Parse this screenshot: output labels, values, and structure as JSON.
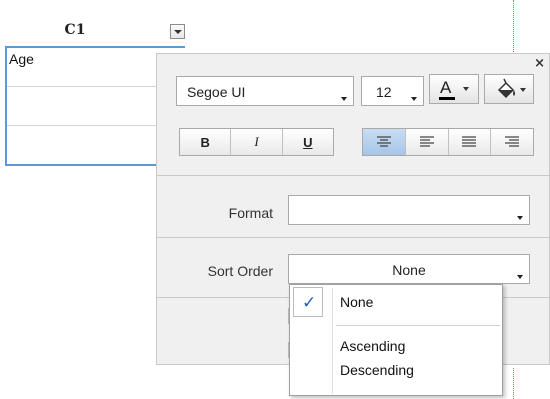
{
  "sheet": {
    "column_header": "C1",
    "cells": [
      "Age",
      "",
      ""
    ]
  },
  "panel": {
    "close_label": "×",
    "font_name": "Segoe UI",
    "font_size": "12",
    "font_color_glyph": "A",
    "fill_icon": "paint-bucket-icon",
    "style_buttons": {
      "bold": "B",
      "italic": "I",
      "underline": "U"
    },
    "align_buttons": [
      "align-center",
      "align-left",
      "align-center",
      "align-right"
    ],
    "active_align_index": 0,
    "format_label": "Format",
    "format_value": "",
    "sort_label": "Sort Order",
    "sort_value": "None"
  },
  "sort_menu": {
    "items": [
      {
        "label": "None",
        "checked": true
      },
      {
        "label": "Ascending",
        "checked": false
      },
      {
        "label": "Descending",
        "checked": false
      }
    ],
    "check_glyph": "✓"
  },
  "colors": {
    "selection_border": "#5b9bd5",
    "active_button": "#b9d2ee",
    "check": "#1f5fbf"
  }
}
